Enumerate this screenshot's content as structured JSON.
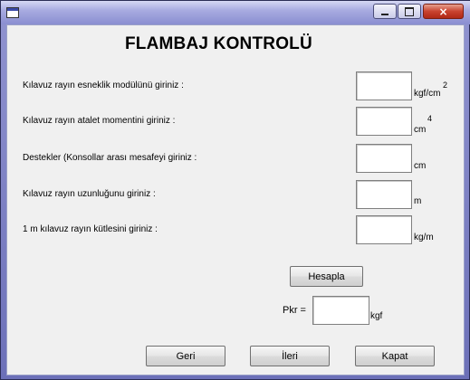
{
  "window": {
    "controls": {
      "minimize": "minimize-icon",
      "maximize": "maximize-icon",
      "close": "×"
    }
  },
  "form": {
    "title": "FLAMBAJ KONTROLÜ",
    "fields": [
      {
        "label": "Kılavuz rayın esneklik modülünü giriniz :",
        "unit": "kgf/cm",
        "sup": "2",
        "value": ""
      },
      {
        "label": "Kılavuz rayın atalet momentini giriniz :",
        "unit": "cm",
        "sup": "4",
        "value": ""
      },
      {
        "label": "Destekler (Konsollar arası mesafeyi giriniz :",
        "unit": "cm",
        "sup": "",
        "value": ""
      },
      {
        "label": "Kılavuz rayın uzunluğunu giriniz :",
        "unit": "m",
        "sup": "",
        "value": ""
      },
      {
        "label": "1 m kılavuz rayın kütlesini giriniz :",
        "unit": "kg/m",
        "sup": "",
        "value": ""
      }
    ],
    "compute_button": "Hesapla",
    "result": {
      "label": "Pkr =",
      "unit": "kgf",
      "value": ""
    },
    "nav": {
      "back": "Geri",
      "next": "İleri",
      "close": "Kapat"
    }
  }
}
